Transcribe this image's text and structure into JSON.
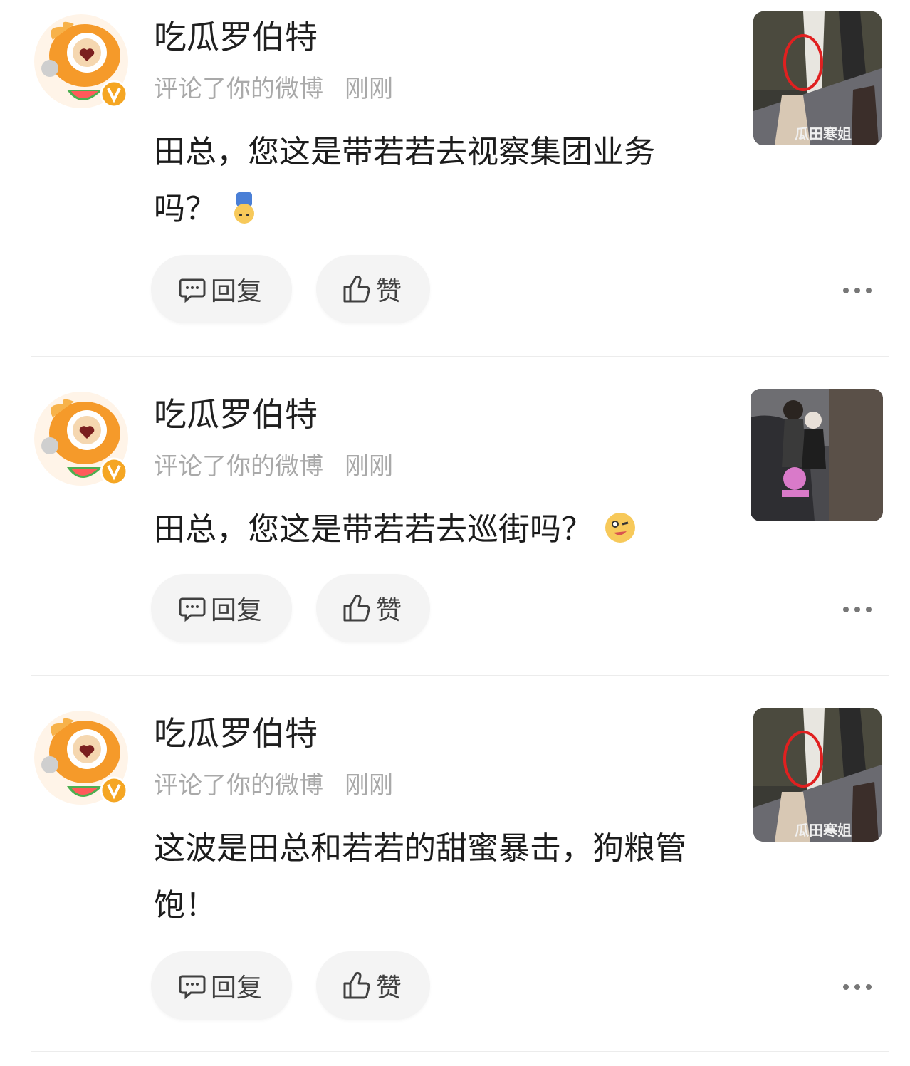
{
  "comments": [
    {
      "username": "吃瓜罗伯特",
      "action": "评论了你的微博",
      "time": "刚刚",
      "text": "田总，您这是带若若去视察集团业务吗？",
      "emoji": "upside-down-figure-emoji",
      "reply_label": "回复",
      "like_label": "赞",
      "thumbnail_watermark": "瓜田寒姐"
    },
    {
      "username": "吃瓜罗伯特",
      "action": "评论了你的微博",
      "time": "刚刚",
      "text": "田总，您这是带若若去巡街吗？",
      "emoji": "winking-face-emoji",
      "reply_label": "回复",
      "like_label": "赞"
    },
    {
      "username": "吃瓜罗伯特",
      "action": "评论了你的微博",
      "time": "刚刚",
      "text": "这波是田总和若若的甜蜜暴击，狗粮管饱！",
      "reply_label": "回复",
      "like_label": "赞",
      "thumbnail_watermark": "瓜田寒姐"
    }
  ],
  "colors": {
    "avatar_orange": "#f59a2a",
    "verified_badge": "#f5a623",
    "meta_gray": "#a9a9a9",
    "pill_bg": "#f4f4f4"
  }
}
